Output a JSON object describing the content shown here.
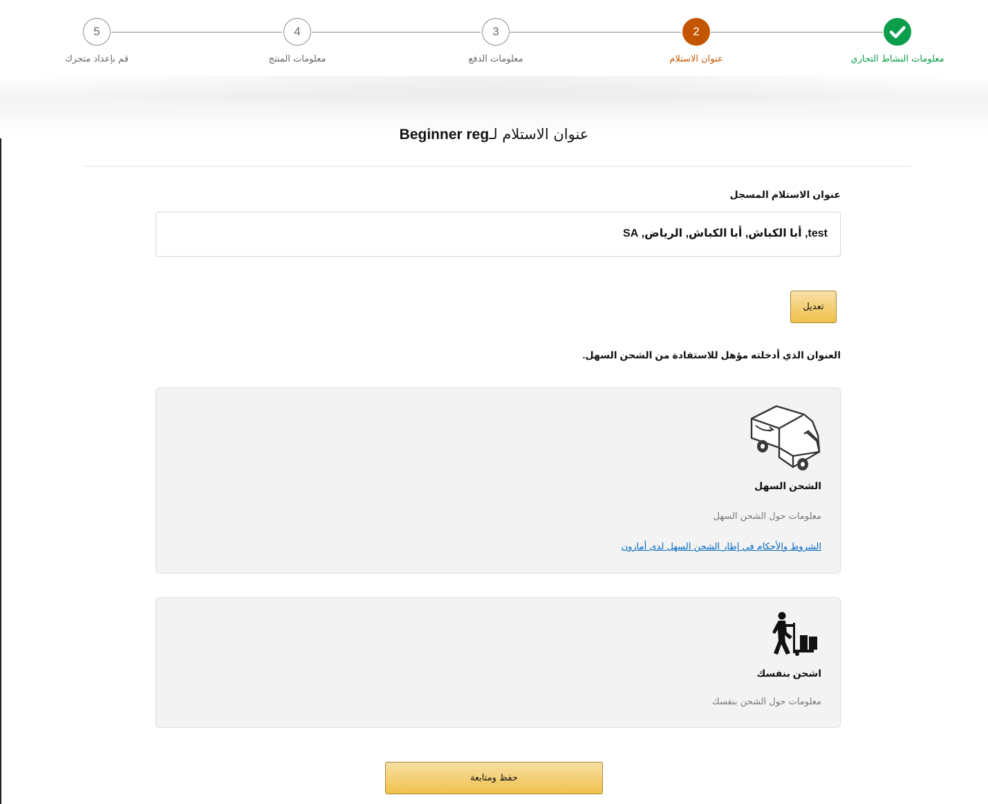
{
  "stepper": {
    "steps": [
      {
        "number": "",
        "label": "معلومات النشاط التجاري",
        "state": "done"
      },
      {
        "number": "2",
        "label": "عنوان الاستلام",
        "state": "active"
      },
      {
        "number": "3",
        "label": "معلومات الدفع",
        "state": "pending"
      },
      {
        "number": "4",
        "label": "معلومات المنتج",
        "state": "pending"
      },
      {
        "number": "5",
        "label": "قم بإعداد متجرك",
        "state": "pending"
      }
    ],
    "done_color": "#0a9d4b",
    "active_color": "#c45500"
  },
  "page": {
    "title_prefix": "عنوان الاستلام لـ",
    "title_name": "Beginner reg"
  },
  "address": {
    "label": "عنوان الاستلام المسجل",
    "value": "test, أبا الكباش, أبا الكباش, الرياض, SA",
    "edit_label": "تعديل"
  },
  "eligibility_note": "العنوان الذي أدخلته مؤهل للاستفادة من الشحن السهل.",
  "options": {
    "easy_ship": {
      "icon": "delivery-van-icon",
      "title": "الشحن السهل",
      "description": "معلومات حول الشحن السهل",
      "link": "الشروط والأحكام في إطار الشحن السهل لدى أمازون"
    },
    "self_ship": {
      "icon": "person-hand-truck-icon",
      "title": "اشحن بنفسك",
      "description": "معلومات حول الشحن بنفسك"
    }
  },
  "footer": {
    "save_label": "حفظ ومتابعة"
  }
}
